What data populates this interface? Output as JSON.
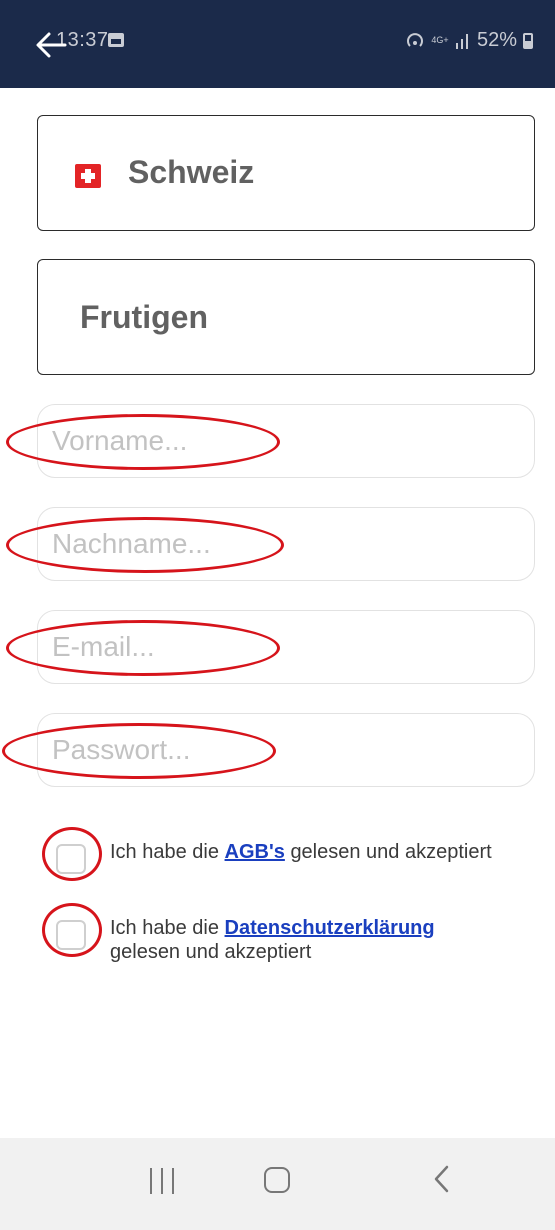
{
  "status_bar": {
    "time": "13:37",
    "network": "4G+",
    "battery": "52%"
  },
  "country_selector": {
    "flag": "swiss-flag",
    "label": "Schweiz"
  },
  "city_selector": {
    "label": "Frutigen"
  },
  "form": {
    "first_name": {
      "placeholder": "Vorname...",
      "value": ""
    },
    "last_name": {
      "placeholder": "Nachname...",
      "value": ""
    },
    "email": {
      "placeholder": "E-mail...",
      "value": ""
    },
    "password": {
      "placeholder": "Passwort...",
      "value": ""
    }
  },
  "consents": {
    "terms": {
      "prefix": "Ich habe die",
      "link": "AGB's",
      "suffix": "gelesen und akzeptiert",
      "checked": false
    },
    "privacy": {
      "prefix": "Ich habe die",
      "link": "Datenschutzerklärung",
      "suffix": "gelesen und akzeptiert",
      "checked": false
    }
  },
  "annotations": {
    "highlight_color": "#d6141b"
  },
  "colors": {
    "header_bg": "#1b2a4a",
    "link": "#1a3fbf",
    "swiss_red": "#e32426"
  },
  "nav_bar": {
    "recent": "recent-apps-icon",
    "home": "home-icon",
    "back": "back-icon"
  }
}
